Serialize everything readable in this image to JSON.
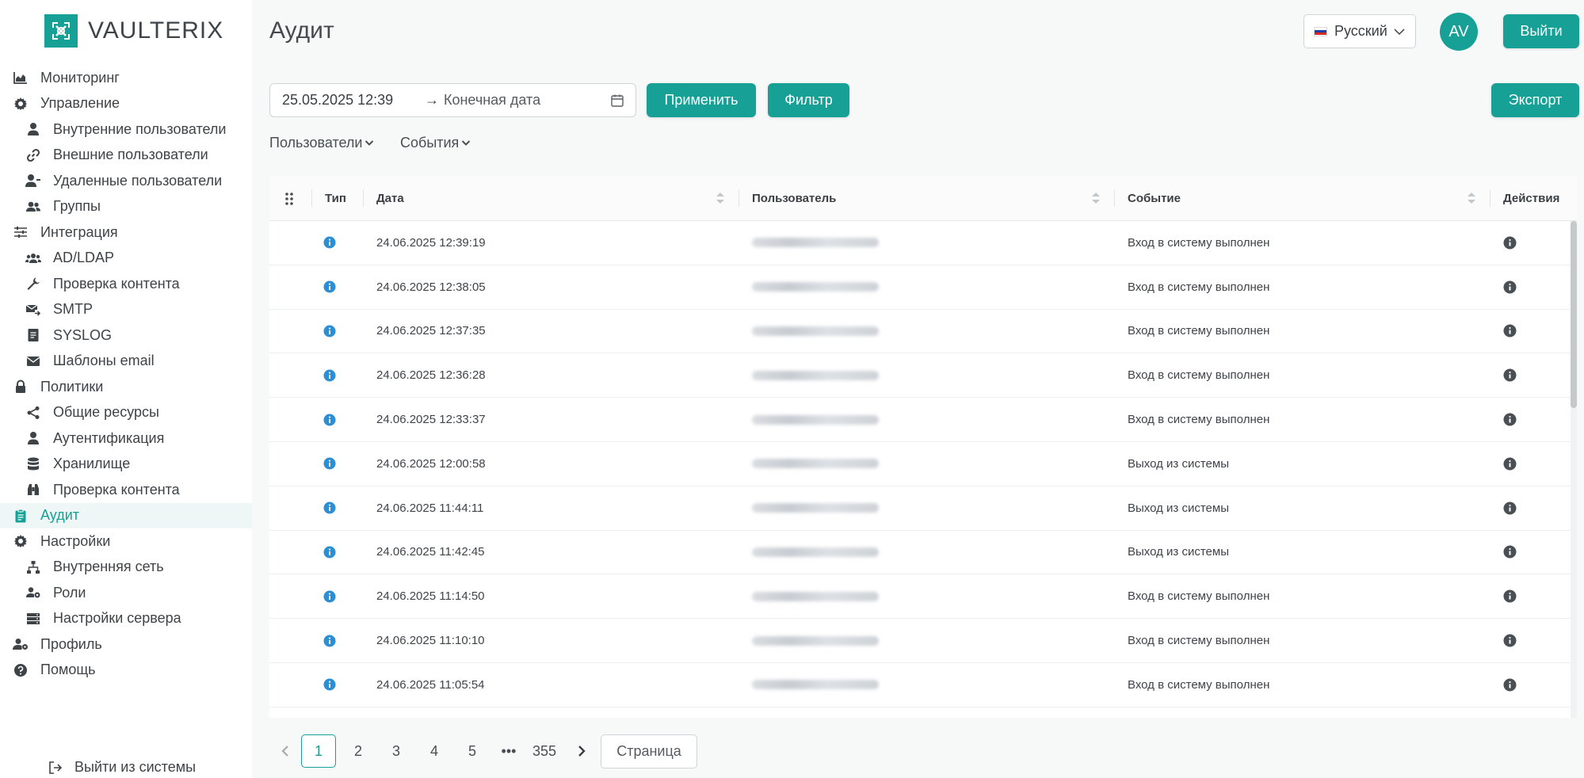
{
  "app": {
    "brand": "VAULTERIX",
    "accent": "#17a096"
  },
  "sidebar": {
    "items": [
      {
        "label": "Мониторинг",
        "icon": "chart-area-icon",
        "level": 0
      },
      {
        "label": "Управление",
        "icon": "gear-icon",
        "level": 0
      },
      {
        "label": "Внутренние пользователи",
        "icon": "user-icon",
        "level": 1
      },
      {
        "label": "Внешние пользователи",
        "icon": "link-icon",
        "level": 1
      },
      {
        "label": "Удаленные пользователи",
        "icon": "user-minus-icon",
        "level": 1
      },
      {
        "label": "Группы",
        "icon": "users-icon",
        "level": 1
      },
      {
        "label": "Интеграция",
        "icon": "sliders-icon",
        "level": 0
      },
      {
        "label": "AD/LDAP",
        "icon": "users-group-icon",
        "level": 1
      },
      {
        "label": "Проверка контента",
        "icon": "wrench-icon",
        "level": 1
      },
      {
        "label": "SMTP",
        "icon": "mail-forward-icon",
        "level": 1
      },
      {
        "label": "SYSLOG",
        "icon": "document-icon",
        "level": 1
      },
      {
        "label": "Шаблоны email",
        "icon": "envelope-icon",
        "level": 1
      },
      {
        "label": "Политики",
        "icon": "lock-icon",
        "level": 0
      },
      {
        "label": "Общие ресурсы",
        "icon": "share-icon",
        "level": 1
      },
      {
        "label": "Аутентификация",
        "icon": "user-icon",
        "level": 1
      },
      {
        "label": "Хранилище",
        "icon": "database-icon",
        "level": 1
      },
      {
        "label": "Проверка контента",
        "icon": "binoculars-icon",
        "level": 1
      },
      {
        "label": "Аудит",
        "icon": "clipboard-icon",
        "level": 0,
        "active": true
      },
      {
        "label": "Настройки",
        "icon": "gear-icon",
        "level": 0
      },
      {
        "label": "Внутренняя сеть",
        "icon": "network-icon",
        "level": 1
      },
      {
        "label": "Роли",
        "icon": "users-cog-icon",
        "level": 1
      },
      {
        "label": "Настройки сервера",
        "icon": "server-icon",
        "level": 1
      },
      {
        "label": "Профиль",
        "icon": "user-cog-icon",
        "level": 0
      },
      {
        "label": "Помощь",
        "icon": "question-circle-icon",
        "level": 0
      }
    ],
    "logout_label": "Выйти из системы"
  },
  "header": {
    "title": "Аудит",
    "language": "Русский",
    "avatar_initials": "AV",
    "logout_label": "Выйти"
  },
  "filters": {
    "start_date": "25.05.2025 12:39",
    "arrow": "→",
    "end_placeholder": "Конечная дата",
    "apply_label": "Применить",
    "filter_label": "Фильтр",
    "export_label": "Экспорт",
    "users_dropdown": "Пользователи",
    "events_dropdown": "События"
  },
  "table": {
    "columns": {
      "type": "Тип",
      "date": "Дата",
      "user": "Пользователь",
      "event": "Событие",
      "actions": "Действия"
    },
    "rows": [
      {
        "date": "24.06.2025 12:39:19",
        "event": "Вход в систему выполнен"
      },
      {
        "date": "24.06.2025 12:38:05",
        "event": "Вход в систему выполнен"
      },
      {
        "date": "24.06.2025 12:37:35",
        "event": "Вход в систему выполнен"
      },
      {
        "date": "24.06.2025 12:36:28",
        "event": "Вход в систему выполнен"
      },
      {
        "date": "24.06.2025 12:33:37",
        "event": "Вход в систему выполнен"
      },
      {
        "date": "24.06.2025 12:00:58",
        "event": "Выход из системы"
      },
      {
        "date": "24.06.2025 11:44:11",
        "event": "Выход из системы"
      },
      {
        "date": "24.06.2025 11:42:45",
        "event": "Выход из системы"
      },
      {
        "date": "24.06.2025 11:14:50",
        "event": "Вход в систему выполнен"
      },
      {
        "date": "24.06.2025 11:10:10",
        "event": "Вход в систему выполнен"
      },
      {
        "date": "24.06.2025 11:05:54",
        "event": "Вход в систему выполнен"
      }
    ]
  },
  "pagination": {
    "pages": [
      "1",
      "2",
      "3",
      "4",
      "5"
    ],
    "ellipsis": "•••",
    "last_page": "355",
    "current": "1",
    "goto_label": "Страница"
  }
}
